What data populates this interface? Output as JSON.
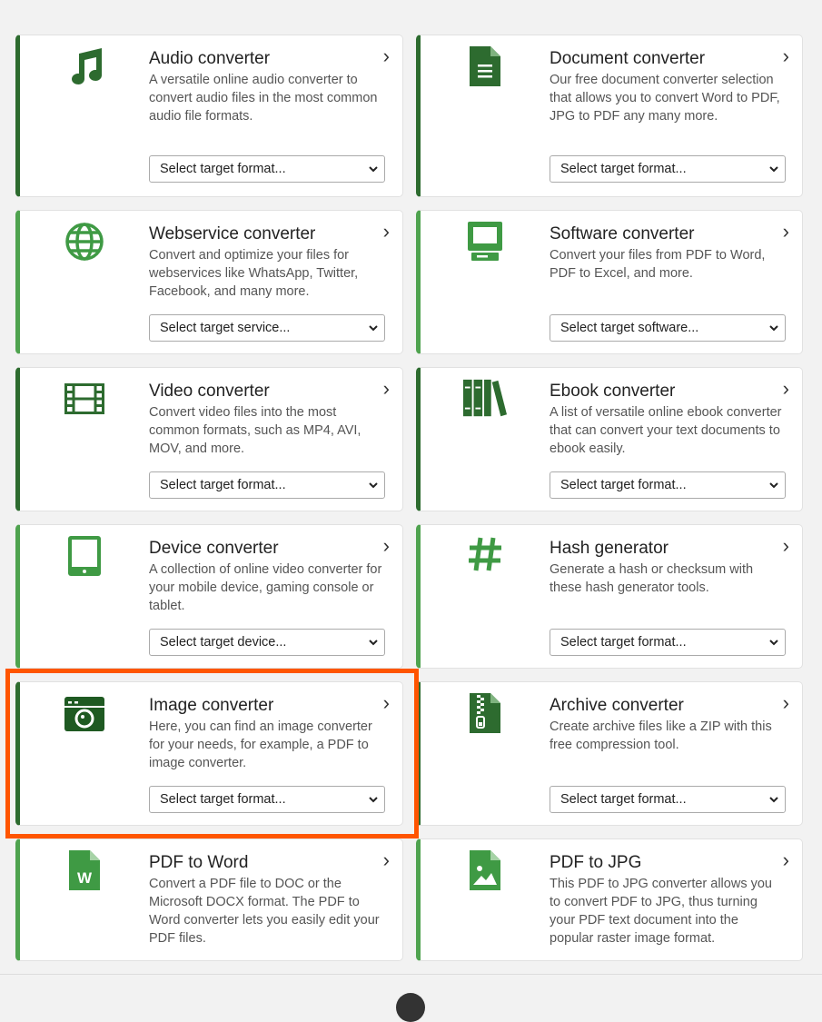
{
  "colors": {
    "accent_dark": "#2d6b2f",
    "accent_light": "#4fa34f",
    "highlight": "#ff5500"
  },
  "cards": [
    {
      "title": "Audio converter",
      "desc": "A versatile online audio converter to convert audio files in the most common audio file formats.",
      "select": "Select target format...",
      "icon": "music-note-icon"
    },
    {
      "title": "Document converter",
      "desc": "Our free document converter selection that allows you to convert Word to PDF, JPG to PDF any many more.",
      "select": "Select target format...",
      "icon": "document-icon"
    },
    {
      "title": "Webservice converter",
      "desc": "Convert and optimize your files for webservices like WhatsApp, Twitter, Facebook, and many more.",
      "select": "Select target service...",
      "icon": "globe-icon"
    },
    {
      "title": "Software converter",
      "desc": "Convert your files from PDF to Word, PDF to Excel, and more.",
      "select": "Select target software...",
      "icon": "computer-icon"
    },
    {
      "title": "Video converter",
      "desc": "Convert video files into the most common formats, such as MP4, AVI, MOV, and more.",
      "select": "Select target format...",
      "icon": "film-icon"
    },
    {
      "title": "Ebook converter",
      "desc": "A list of versatile online ebook converter that can convert your text documents to ebook easily.",
      "select": "Select target format...",
      "icon": "books-icon"
    },
    {
      "title": "Device converter",
      "desc": "A collection of online video converter for your mobile device, gaming console or tablet.",
      "select": "Select target device...",
      "icon": "tablet-icon"
    },
    {
      "title": "Hash generator",
      "desc": "Generate a hash or checksum with these hash generator tools.",
      "select": "Select target format...",
      "icon": "hash-icon"
    },
    {
      "title": "Image converter",
      "desc": "Here, you can find an image converter for your needs, for example, a PDF to image converter.",
      "select": "Select target format...",
      "icon": "camera-icon"
    },
    {
      "title": "Archive converter",
      "desc": "Create archive files like a ZIP with this free compression tool.",
      "select": "Select target format...",
      "icon": "zip-file-icon"
    },
    {
      "title": "PDF to Word",
      "desc": "Convert a PDF file to DOC or the Microsoft DOCX format. The PDF to Word converter lets you easily edit your PDF files.",
      "icon": "word-file-icon"
    },
    {
      "title": "PDF to JPG",
      "desc": "This PDF to JPG converter allows you to convert PDF to JPG, thus turning your PDF text document into the popular raster image format.",
      "icon": "image-file-icon"
    }
  ]
}
